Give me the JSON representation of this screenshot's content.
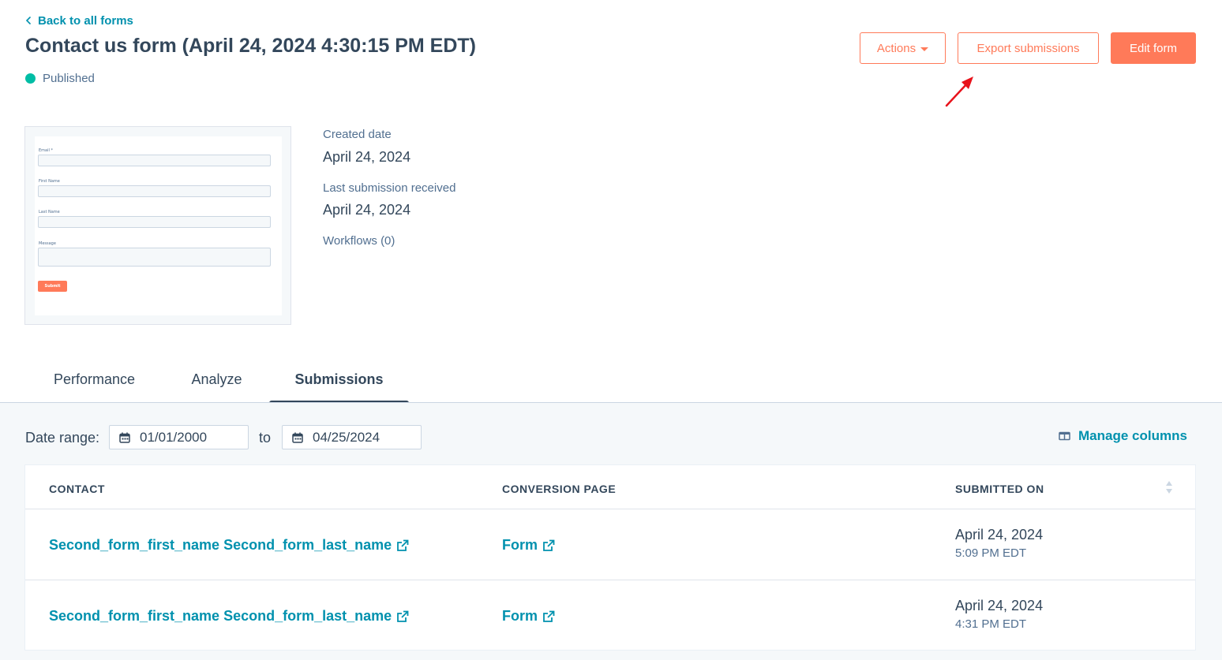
{
  "header": {
    "back_label": "Back to all forms",
    "title": "Contact us form (April 24, 2024 4:30:15 PM EDT)",
    "status": "Published"
  },
  "toolbar": {
    "actions_label": "Actions",
    "export_label": "Export submissions",
    "edit_label": "Edit form"
  },
  "preview": {
    "fields": [
      "Email *",
      "First Name",
      "Last Name",
      "Message"
    ],
    "submit_label": "Submit"
  },
  "details": {
    "created_label": "Created date",
    "created_value": "April 24, 2024",
    "last_label": "Last submission received",
    "last_value": "April 24, 2024",
    "workflows_label": "Workflows (0)"
  },
  "tabs": [
    "Performance",
    "Analyze",
    "Submissions"
  ],
  "filters": {
    "date_range_label": "Date range:",
    "start_date": "01/01/2000",
    "to_label": "to",
    "end_date": "04/25/2024",
    "manage_columns_label": "Manage columns"
  },
  "table": {
    "columns": [
      "CONTACT",
      "CONVERSION PAGE",
      "SUBMITTED ON"
    ],
    "rows": [
      {
        "contact": "Second_form_first_name Second_form_last_name",
        "page": "Form",
        "date": "April 24, 2024",
        "time": "5:09 PM EDT"
      },
      {
        "contact": "Second_form_first_name Second_form_last_name",
        "page": "Form",
        "date": "April 24, 2024",
        "time": "4:31 PM EDT"
      }
    ]
  },
  "colors": {
    "accent": "#ff7a59",
    "link": "#0091ae",
    "text": "#33475b",
    "published": "#00bda5",
    "annotation_arrow": "#e8121b"
  }
}
